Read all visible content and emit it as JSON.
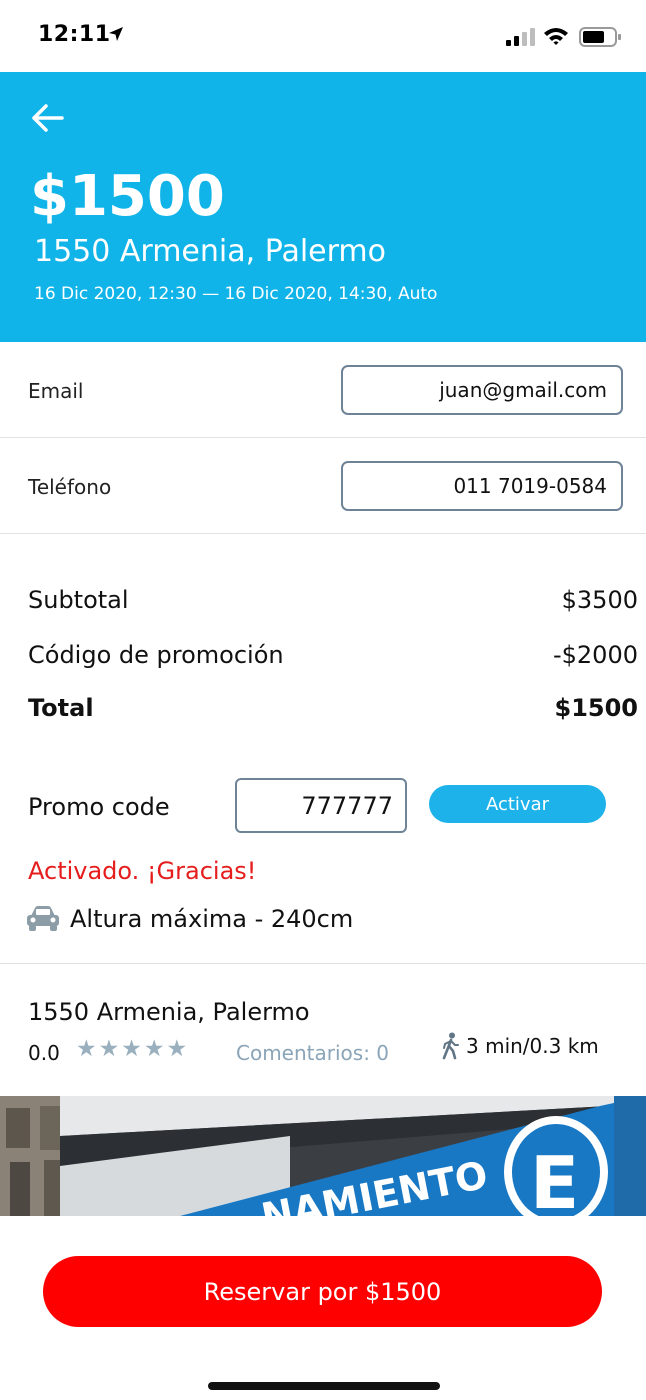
{
  "status_bar": {
    "time": "12:11",
    "icons": [
      "location-arrow-icon",
      "cellular-signal-icon",
      "wifi-icon",
      "battery-icon"
    ]
  },
  "header": {
    "back_icon": "back-arrow-icon",
    "price": "$1500",
    "address": "1550 Armenia, Palermo",
    "dates": "16 Dic 2020, 12:30 — 16 Dic 2020, 14:30, Auto",
    "background_color": "#11b4e8"
  },
  "form": {
    "email_label": "Email",
    "email_value": "juan@gmail.com",
    "phone_label": "Teléfono",
    "phone_value": "011 7019-0584"
  },
  "summary": {
    "subtotal_label": "Subtotal",
    "subtotal_value": "$3500",
    "promo_label": "Código de promoción",
    "promo_value": "-$2000",
    "total_label": "Total",
    "total_value": "$1500"
  },
  "promo": {
    "label": "Promo code",
    "code_value": "777777",
    "activate_label": "Activar",
    "status": "Activado. ¡Gracias!",
    "status_color": "#e51d1d"
  },
  "vehicle": {
    "icon": "car-icon",
    "height_text": "Altura máxima - 240cm"
  },
  "location": {
    "address": "1550 Armenia, Palermo",
    "rating": "0.0",
    "stars": "★★★★★",
    "comments": "Comentarios: 0",
    "walk_icon": "walking-person-icon",
    "walk_distance": "3 min/0.3 km"
  },
  "photo": {
    "sign_text": "NAMIENTO",
    "sign_letter": "E"
  },
  "reserve": {
    "label": "Reservar por $1500",
    "color": "#fe0000"
  }
}
